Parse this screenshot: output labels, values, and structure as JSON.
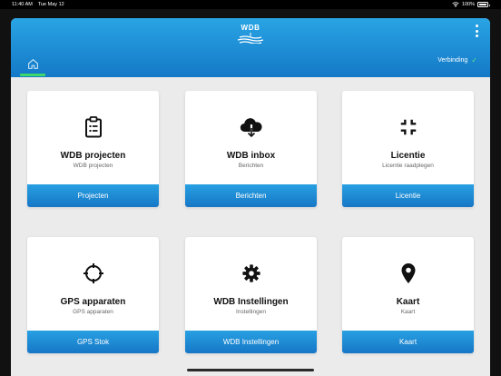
{
  "status_bar": {
    "time": "11:40 AM",
    "date": "Tue May 12",
    "battery": "100%",
    "wifi_icon": "wifi-icon",
    "battery_icon": "battery-icon"
  },
  "header": {
    "logo_text": "WDB",
    "logo_icon": "wdb-waves-logo",
    "menu_icon": "more-vertical-icon",
    "home_icon": "home-icon",
    "connection_label": "Verbinding",
    "connection_icon": "check-icon",
    "connection_check": "✓",
    "active_tab_color": "#3fd86a",
    "gradient_top": "#29a4e4",
    "gradient_bottom": "#1479c7"
  },
  "cards": [
    {
      "title": "WDB projecten",
      "subtitle": "WDB projecten",
      "button": "Projecten",
      "icon": "clipboard-icon"
    },
    {
      "title": "WDB inbox",
      "subtitle": "Berichten",
      "button": "Berichten",
      "icon": "cloud-download-icon"
    },
    {
      "title": "Licentie",
      "subtitle": "Licentie raadplegen",
      "button": "Licentie",
      "icon": "fullscreen-exit-icon"
    },
    {
      "title": "GPS apparaten",
      "subtitle": "GPS apparaten",
      "button": "GPS Stok",
      "icon": "gps-crosshair-icon"
    },
    {
      "title": "WDB Instellingen",
      "subtitle": "Instellingen",
      "button": "WDB Instellingen",
      "icon": "gear-icon"
    },
    {
      "title": "Kaart",
      "subtitle": "Kaart",
      "button": "Kaart",
      "icon": "map-pin-icon"
    }
  ]
}
